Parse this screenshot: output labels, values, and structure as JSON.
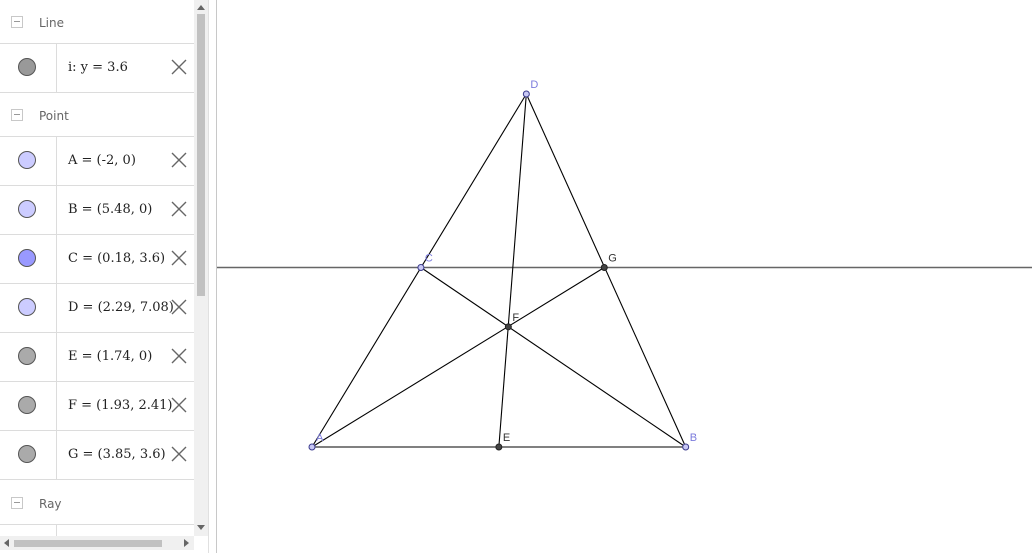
{
  "algebra": {
    "groups": [
      {
        "label": "Line"
      },
      {
        "label": "Point"
      },
      {
        "label": "Ray"
      }
    ],
    "rows": [
      {
        "text": "i: y = 3.6",
        "color": "#999999"
      },
      {
        "text": "A = (-2, 0)",
        "color": "#ccccff"
      },
      {
        "text": "B = (5.48, 0)",
        "color": "#ccccff"
      },
      {
        "text": "C = (0.18, 3.6)",
        "color": "#9999ff"
      },
      {
        "text": "D = (2.29, 7.08)",
        "color": "#ccccff"
      },
      {
        "text": "E = (1.74, 0)",
        "color": "#aaaaaa"
      },
      {
        "text": "F = (1.93, 2.41)",
        "color": "#aaaaaa"
      },
      {
        "text": "G = (3.85, 3.6)",
        "color": "#aaaaaa"
      }
    ]
  },
  "graphics": {
    "line_color": "#666666",
    "segment_color": "#000000",
    "free_point_color": "#7b7bdc",
    "dependent_point_color": "#333333",
    "points": [
      {
        "label": "A",
        "x": -2,
        "y": 0,
        "free": true
      },
      {
        "label": "B",
        "x": 5.48,
        "y": 0,
        "free": true
      },
      {
        "label": "C",
        "x": 0.18,
        "y": 3.6,
        "free": true
      },
      {
        "label": "D",
        "x": 2.29,
        "y": 7.08,
        "free": true
      },
      {
        "label": "E",
        "x": 1.74,
        "y": 0,
        "free": false
      },
      {
        "label": "F",
        "x": 1.93,
        "y": 2.41,
        "free": false
      },
      {
        "label": "G",
        "x": 3.85,
        "y": 3.6,
        "free": false
      }
    ],
    "segments": [
      [
        "A",
        "B"
      ],
      [
        "A",
        "D"
      ],
      [
        "D",
        "B"
      ],
      [
        "A",
        "G"
      ],
      [
        "C",
        "B"
      ],
      [
        "D",
        "E"
      ]
    ],
    "horizontal_line_y": 3.6
  }
}
